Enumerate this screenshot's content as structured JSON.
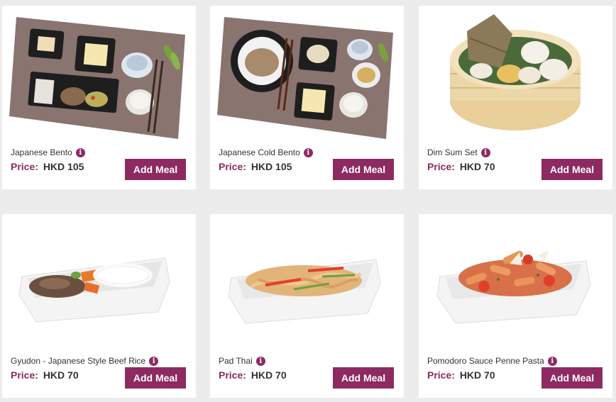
{
  "meals": [
    {
      "name": "Japanese Bento",
      "price_label": "Price:",
      "price": "HKD 105",
      "button": "Add Meal",
      "info_glyph": "i"
    },
    {
      "name": "Japanese Cold Bento",
      "price_label": "Price:",
      "price": "HKD 105",
      "button": "Add Meal",
      "info_glyph": "i"
    },
    {
      "name": "Dim Sum Set",
      "price_label": "Price:",
      "price": "HKD 70",
      "button": "Add Meal",
      "info_glyph": "i"
    },
    {
      "name": "Gyudon - Japanese Style Beef Rice",
      "price_label": "Price:",
      "price": "HKD 70",
      "button": "Add Meal",
      "info_glyph": "i"
    },
    {
      "name": "Pad Thai",
      "price_label": "Price:",
      "price": "HKD 70",
      "button": "Add Meal",
      "info_glyph": "i"
    },
    {
      "name": "Pomodoro Sauce Penne Pasta",
      "price_label": "Price:",
      "price": "HKD 70",
      "button": "Add Meal",
      "info_glyph": "i"
    }
  ],
  "colors": {
    "accent": "#8e2a62",
    "page_background": "#ececec",
    "card_background": "#ffffff",
    "text": "#333333"
  },
  "icons": {
    "info": "info-icon"
  }
}
